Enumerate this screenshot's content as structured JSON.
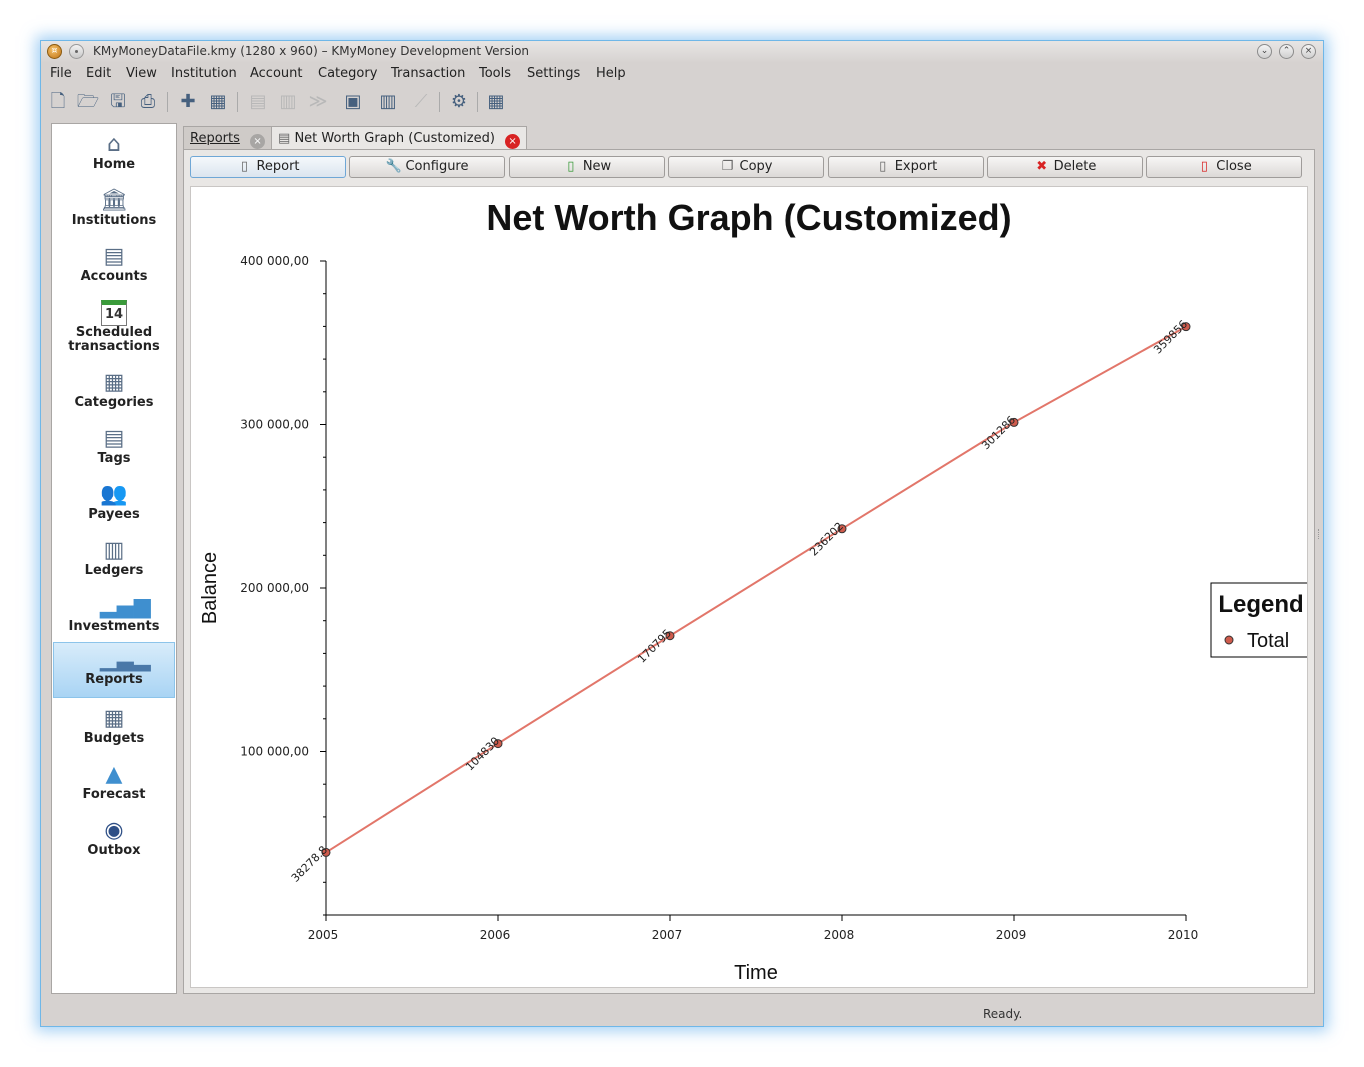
{
  "window": {
    "title": "KMyMoneyDataFile.kmy (1280 x 960) – KMyMoney Development Version"
  },
  "menu": [
    "File",
    "Edit",
    "View",
    "Institution",
    "Account",
    "Category",
    "Transaction",
    "Tools",
    "Settings",
    "Help"
  ],
  "toolbar": {
    "icons": [
      "new-file-icon",
      "open-folder-icon",
      "save-icon",
      "print-icon",
      "new-institution-icon",
      "new-account-icon",
      "edit-account-icon",
      "delete-account-icon",
      "reconcile-icon",
      "report-view-icon",
      "chart-bar-icon",
      "chart-line-icon",
      "settings-icon",
      "calculator-icon"
    ]
  },
  "sidebar": {
    "items": [
      {
        "label": "Home",
        "icon": "home-icon"
      },
      {
        "label": "Institutions",
        "icon": "bank-icon"
      },
      {
        "label": "Accounts",
        "icon": "ledger-icon"
      },
      {
        "label": "Scheduled\ntransactions",
        "icon": "calendar-icon",
        "badge": "14"
      },
      {
        "label": "Categories",
        "icon": "categories-icon"
      },
      {
        "label": "Tags",
        "icon": "tag-icon"
      },
      {
        "label": "Payees",
        "icon": "people-icon"
      },
      {
        "label": "Ledgers",
        "icon": "ledger-icon"
      },
      {
        "label": "Investments",
        "icon": "investments-icon"
      },
      {
        "label": "Reports",
        "icon": "reports-icon",
        "active": true
      },
      {
        "label": "Budgets",
        "icon": "budget-icon"
      },
      {
        "label": "Forecast",
        "icon": "forecast-icon"
      },
      {
        "label": "Outbox",
        "icon": "outbox-icon"
      }
    ]
  },
  "tabs": [
    {
      "label": "Reports",
      "active": false
    },
    {
      "label": "Net Worth Graph (Customized)",
      "active": true
    }
  ],
  "actions": [
    {
      "label": "Report",
      "icon": "document-icon",
      "active": true
    },
    {
      "label": "Configure",
      "icon": "wrench-icon"
    },
    {
      "label": "New",
      "icon": "new-document-icon"
    },
    {
      "label": "Copy",
      "icon": "copy-icon"
    },
    {
      "label": "Export",
      "icon": "export-icon"
    },
    {
      "label": "Delete",
      "icon": "delete-icon"
    },
    {
      "label": "Close",
      "icon": "close-document-icon"
    }
  ],
  "status": {
    "text": "Ready."
  },
  "colors": {
    "series": "#e2766a",
    "point": "#cf5b4c",
    "active": "#a9d4f4"
  },
  "chart_data": {
    "type": "line",
    "title": "Net Worth Graph (Customized)",
    "xlabel": "Time",
    "ylabel": "Balance",
    "x": [
      "2005",
      "2006",
      "2007",
      "2008",
      "2009",
      "2010"
    ],
    "ylim": [
      0,
      400000
    ],
    "yticks": [
      100000,
      200000,
      300000,
      400000
    ],
    "ytick_labels": [
      "100 000,00",
      "200 000,00",
      "300 000,00",
      "400 000,00"
    ],
    "series": [
      {
        "name": "Total",
        "values": [
          38278.8,
          104830,
          170795,
          236202,
          301286,
          359856
        ],
        "labels": [
          "38278.8",
          "104830",
          "170795",
          "236202",
          "301286",
          "359856"
        ]
      }
    ],
    "legend": {
      "title": "Legend",
      "position": "right"
    },
    "grid": false
  }
}
